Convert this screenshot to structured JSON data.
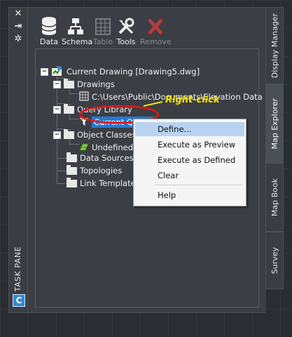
{
  "left_strip": {
    "close_glyph": "✕",
    "pin_glyph": "⇥",
    "settings_glyph": "✲",
    "title": "TASK PANE",
    "app_letter": "C"
  },
  "toolbar": {
    "data_label": "Data",
    "schema_label": "Schema",
    "table_label": "Table",
    "tools_label": "Tools",
    "remove_label": "Remove"
  },
  "tree": {
    "root": "Current Drawing [Drawing5.dwg]",
    "drawings": "Drawings",
    "drawing_path": "C:\\Users\\Public\\Documents\\Elevation Data",
    "query_library": "Query Library",
    "current_query": "Current Query",
    "object_classes": "Object Classes",
    "undefined": "Undefined",
    "data_sources": "Data Sources",
    "topologies": "Topologies",
    "link_templates": "Link Templates",
    "expand_minus": "−",
    "expand_plus": "+"
  },
  "context_menu": {
    "items": [
      "Define...",
      "Execute as Preview",
      "Execute as Defined",
      "Clear",
      "Help"
    ],
    "highlighted": "Define..."
  },
  "annotation": {
    "text": "Right-click",
    "color": "#f5e400",
    "circle_color": "#e01818"
  },
  "tabs": {
    "display_manager": "Display Manager",
    "map_explorer": "Map Explorer",
    "map_book": "Map Book",
    "survey": "Survey",
    "active": "Map Explorer"
  },
  "colors": {
    "selection": "#2878d0",
    "menu_highlight": "#b8d3f0",
    "panel": "#3b3e44"
  }
}
